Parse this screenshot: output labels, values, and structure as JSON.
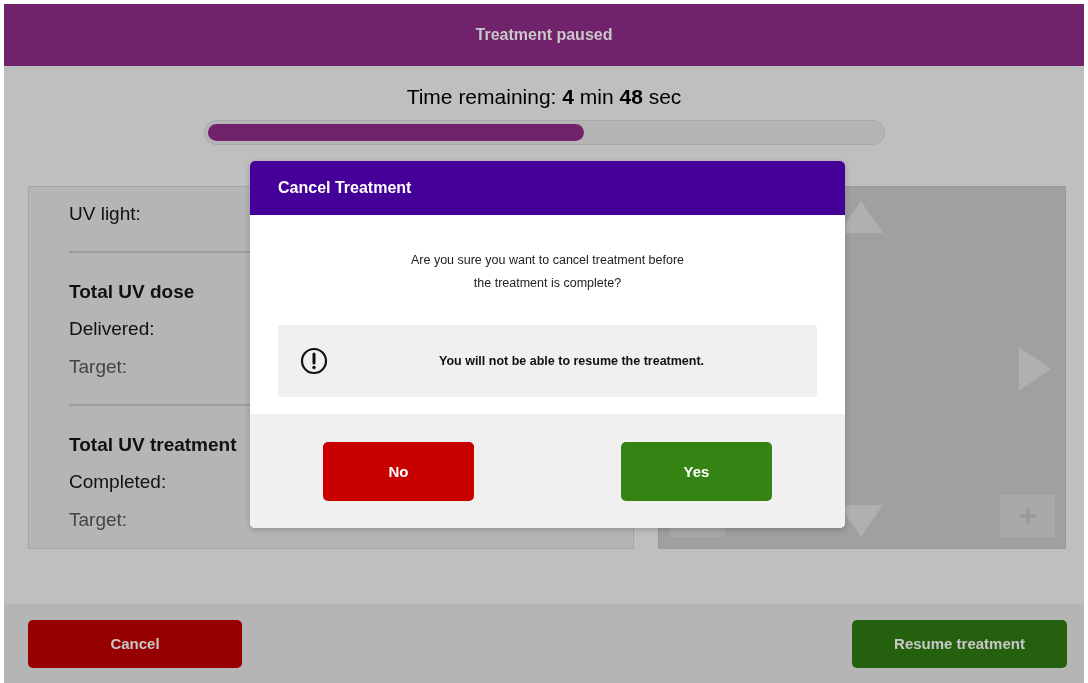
{
  "header": {
    "title": "Treatment paused"
  },
  "timer": {
    "text": "Time remaining: **4** min **48** sec"
  },
  "progress": {
    "level": 0.56
  },
  "info_panel": {
    "items": [
      {
        "kind": "label",
        "text": "UV light:"
      },
      {
        "kind": "divider"
      },
      {
        "kind": "heading",
        "text": "Total UV dose"
      },
      {
        "kind": "label",
        "text": "Delivered:"
      },
      {
        "kind": "muted",
        "text": "Target:"
      },
      {
        "kind": "divider"
      },
      {
        "kind": "heading",
        "text": "Total UV treatment"
      },
      {
        "kind": "label",
        "text": "Completed:"
      },
      {
        "kind": "muted",
        "text": "Target:"
      }
    ]
  },
  "dialog": {
    "title": "Cancel Treatment",
    "message": "Are you sure you want to cancel treatment before the treatment is complete?",
    "warning": "You will not be able to resume the treatment.",
    "buttons": [
      {
        "kind": "danger",
        "label": "No"
      },
      {
        "kind": "confirm",
        "label": "Yes"
      }
    ]
  },
  "footer": {
    "buttons": [
      {
        "kind": "danger",
        "label": "Cancel"
      },
      {
        "kind": "confirm",
        "label": "Resume treatment"
      }
    ]
  }
}
